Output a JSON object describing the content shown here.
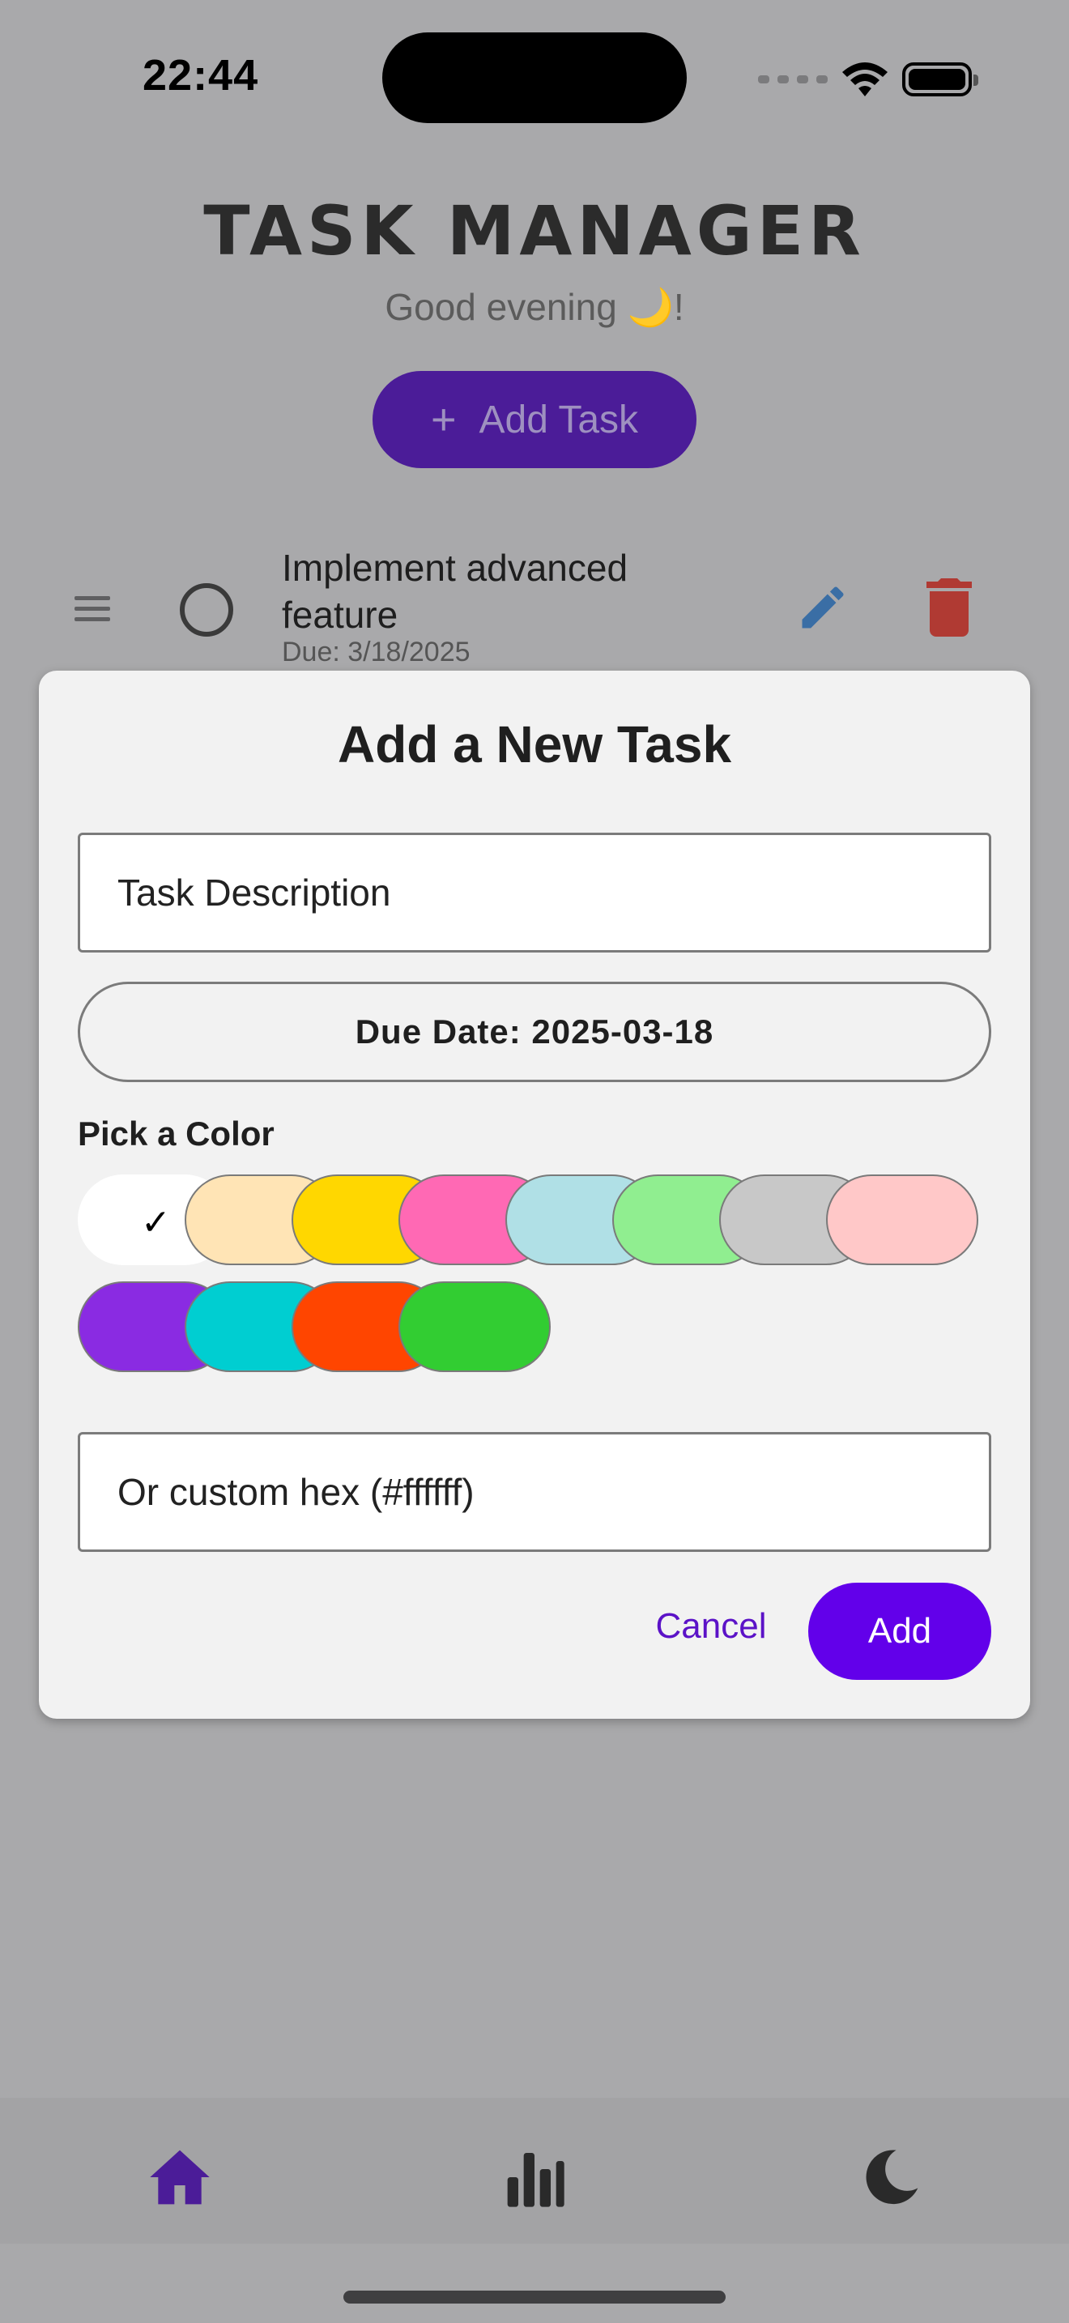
{
  "status_bar": {
    "time": "22:44"
  },
  "header": {
    "title": "TASK MANAGER",
    "greeting": "Good evening 🌙!",
    "add_task_label": "Add Task",
    "add_task_plus": "+"
  },
  "tasks": [
    {
      "title": "Implement advanced feature",
      "due": "Due: 3/18/2025"
    }
  ],
  "modal": {
    "title": "Add a New Task",
    "description_placeholder": "Task Description",
    "due_date_label": "Due Date: 2025-03-18",
    "color_label": "Pick a Color",
    "colors": [
      "#ffffff",
      "#ffe4b5",
      "#ffd700",
      "#ff69b4",
      "#b0e0e6",
      "#90ee90",
      "#c8c8c8",
      "#ffc8c8",
      "#8a2be2",
      "#00ced1",
      "#ff4500",
      "#32cd32"
    ],
    "selected_color": "#ffffff",
    "selected_mark": "✓",
    "hex_placeholder": "Or custom hex (#ffffff)",
    "cancel_label": "Cancel",
    "add_label": "Add"
  },
  "nav": {
    "items": [
      "home-icon",
      "stats-icon",
      "dark-mode-icon"
    ],
    "active": "home-icon",
    "active_color": "#4b1c98"
  }
}
